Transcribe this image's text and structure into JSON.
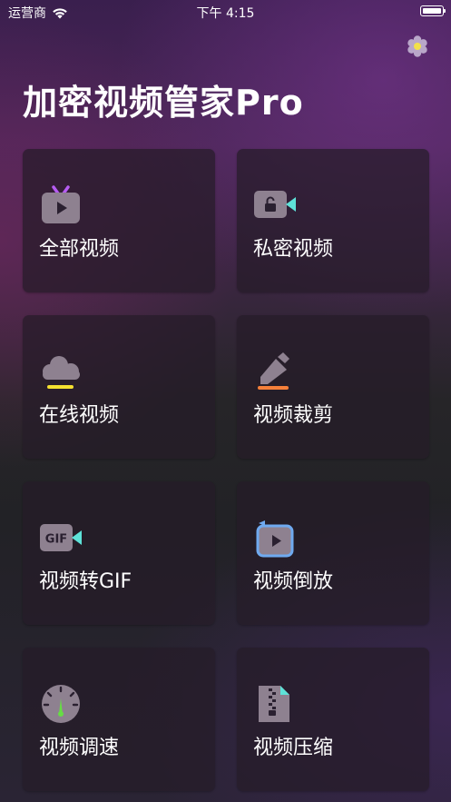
{
  "status_bar": {
    "carrier": "运营商",
    "time": "下午 4:15",
    "battery_level": 1.0
  },
  "header": {
    "title": "加密视频管家Pro"
  },
  "tiles": [
    {
      "label": "全部视频",
      "icon": "tv-play-icon"
    },
    {
      "label": "私密视频",
      "icon": "lock-camera-icon"
    },
    {
      "label": "在线视频",
      "icon": "cloud-icon"
    },
    {
      "label": "视频裁剪",
      "icon": "pencil-icon"
    },
    {
      "label": "视频转GIF",
      "icon": "gif-camera-icon"
    },
    {
      "label": "视频倒放",
      "icon": "reverse-play-icon"
    },
    {
      "label": "视频调速",
      "icon": "speedometer-icon"
    },
    {
      "label": "视频压缩",
      "icon": "zip-file-icon"
    }
  ],
  "colors": {
    "accent_cyan": "#5ee2d8",
    "accent_purple": "#b65cf2",
    "accent_yellow": "#f5e030",
    "accent_orange": "#f5803a",
    "accent_blue": "#6faaf0",
    "accent_green": "#66dd44"
  }
}
